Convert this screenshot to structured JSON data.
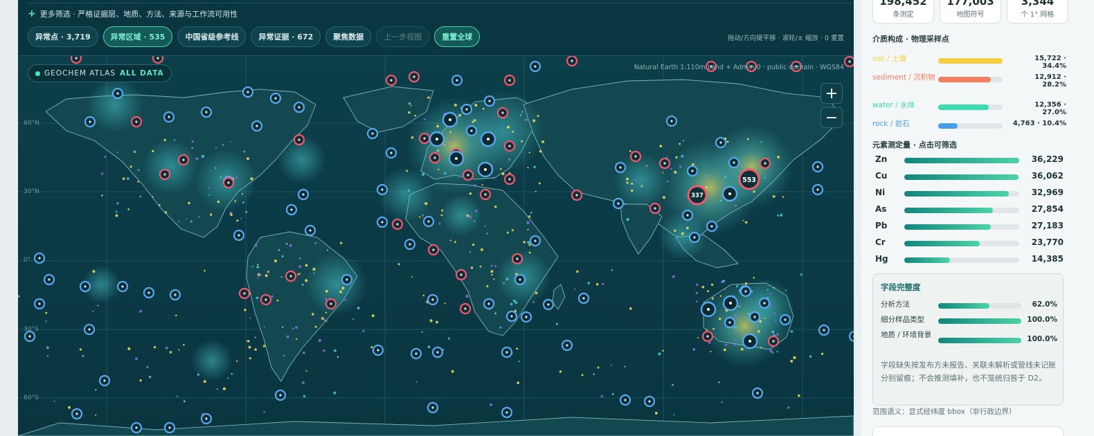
{
  "toolbar": {
    "more_filters": "更多筛选 · 严格证据层、地质、方法、来源与工作流可用性",
    "chips": [
      {
        "label": "异常点 · 3,719",
        "state": "normal"
      },
      {
        "label": "异常区域 · 535",
        "state": "active"
      },
      {
        "label": "中国省级参考线",
        "state": "normal"
      },
      {
        "label": "异常证据 · 672",
        "state": "normal"
      },
      {
        "label": "聚焦数据",
        "state": "normal"
      },
      {
        "label": "上一步视图",
        "state": "disabled"
      },
      {
        "label": "重置全球",
        "state": "active"
      }
    ],
    "hint": "拖动/方向键平移 · 滚轮/± 缩放 · 0 重置"
  },
  "map": {
    "badge_prefix": "GEOCHEM ATLAS",
    "badge_mode": "ALL DATA",
    "attribution": "Natural Earth 1:110m Land + Admin-0 · public domain · WGS84",
    "zoom_in": "+",
    "zoom_out": "−",
    "lat_labels": [
      "60°N",
      "30°N",
      "0°",
      "30°S",
      "60°S"
    ],
    "cluster_labels": [
      "553",
      "337"
    ]
  },
  "stats": [
    {
      "value": "198,452",
      "label": "条测定"
    },
    {
      "value": "177,003",
      "label": "地图符号"
    },
    {
      "value": "3,344",
      "label": "个 1° 网格"
    }
  ],
  "media": {
    "title": "介质构成 · 物理采样点",
    "items": [
      {
        "name": "soil / 土壤",
        "value": "15,722 · 34.4%",
        "fraction": 0.344,
        "color": "#f5cf3f"
      },
      {
        "name": "sediment / 沉积物",
        "value": "12,912 · 28.2%",
        "fraction": 0.282,
        "color": "#f57e5f"
      },
      {
        "name": "water / 水体",
        "value": "12,356 · 27.0%",
        "fraction": 0.27,
        "color": "#3ddbb0"
      },
      {
        "name": "rock / 岩石",
        "value": "4,763 · 10.4%",
        "fraction": 0.104,
        "color": "#4a9ee8"
      }
    ]
  },
  "elements": {
    "title": "元素测定量 · 点击可筛选",
    "items": [
      {
        "symbol": "Zn",
        "value": "36,229",
        "count": 36229
      },
      {
        "symbol": "Cu",
        "value": "36,062",
        "count": 36062
      },
      {
        "symbol": "Ni",
        "value": "32,969",
        "count": 32969
      },
      {
        "symbol": "As",
        "value": "27,854",
        "count": 27854
      },
      {
        "symbol": "Pb",
        "value": "27,183",
        "count": 27183
      },
      {
        "symbol": "Cr",
        "value": "23,770",
        "count": 23770
      },
      {
        "symbol": "Hg",
        "value": "14,385",
        "count": 14385
      }
    ]
  },
  "completeness": {
    "title": "字段完整度",
    "items": [
      {
        "name": "分析方法",
        "value": "62.0%",
        "fraction": 0.62
      },
      {
        "name": "细分样品类型",
        "value": "100.0%",
        "fraction": 1.0
      },
      {
        "name": "地质 / 环境背景",
        "value": "100.0%",
        "fraction": 1.0
      }
    ],
    "note": "字段缺失按发布方未报告、关联未解析或管线未记账分别留痕；不会推测填补，也不笼统归咎于 D2。",
    "scope": "范围语义：显式经纬度 bbox（非行政边界）"
  }
}
